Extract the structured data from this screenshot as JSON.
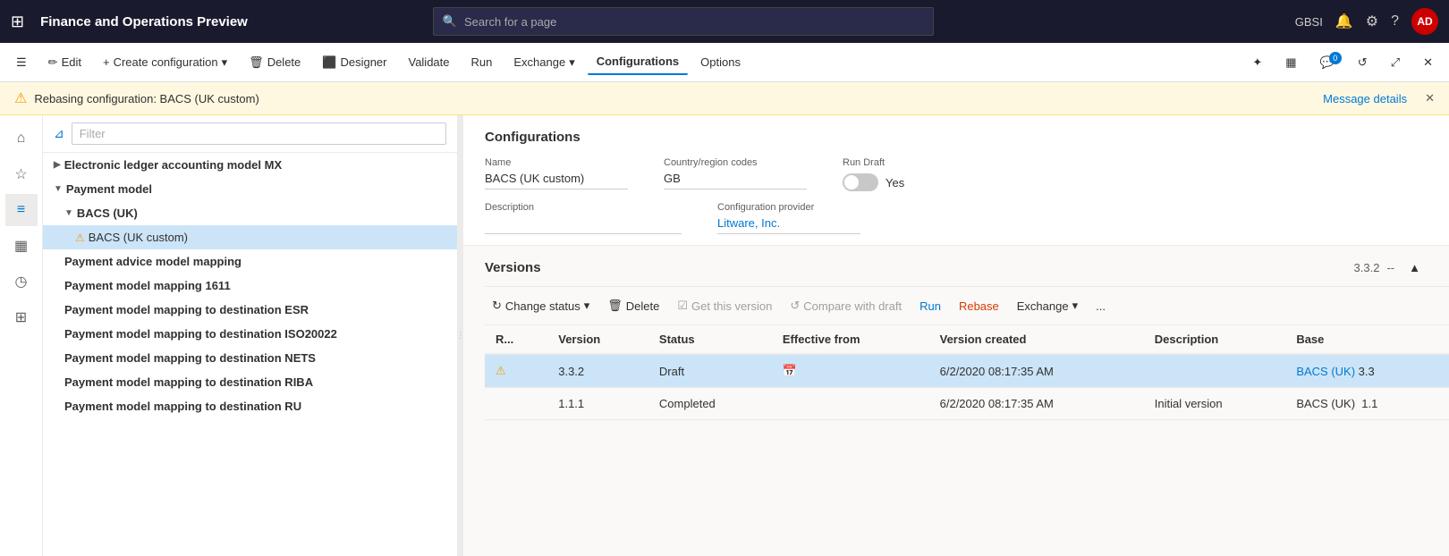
{
  "app": {
    "title": "Finance and Operations Preview",
    "grid_icon": "⊞"
  },
  "search": {
    "placeholder": "Search for a page"
  },
  "header_right": {
    "user_initials": "AD",
    "region": "GBSI"
  },
  "command_bar": {
    "edit": "Edit",
    "create_config": "Create configuration",
    "delete": "Delete",
    "designer": "Designer",
    "validate": "Validate",
    "run": "Run",
    "exchange": "Exchange",
    "configurations": "Configurations",
    "options": "Options"
  },
  "warning_banner": {
    "message": "Rebasing configuration: BACS (UK custom)",
    "link": "Message details"
  },
  "tree": {
    "filter_placeholder": "Filter",
    "items": [
      {
        "label": "Electronic ledger accounting model MX",
        "level": 1,
        "has_chevron": true,
        "collapsed": true,
        "warn": false
      },
      {
        "label": "Payment model",
        "level": 1,
        "has_chevron": true,
        "collapsed": false,
        "warn": false
      },
      {
        "label": "BACS (UK)",
        "level": 2,
        "has_chevron": true,
        "collapsed": false,
        "warn": false
      },
      {
        "label": "⚠BACS (UK custom)",
        "level": 3,
        "selected": true,
        "warn": true
      },
      {
        "label": "Payment advice model mapping",
        "level": 2,
        "has_chevron": false
      },
      {
        "label": "Payment model mapping 1611",
        "level": 2,
        "has_chevron": false
      },
      {
        "label": "Payment model mapping to destination ESR",
        "level": 2,
        "has_chevron": false
      },
      {
        "label": "Payment model mapping to destination ISO20022",
        "level": 2,
        "has_chevron": false
      },
      {
        "label": "Payment model mapping to destination NETS",
        "level": 2,
        "has_chevron": false
      },
      {
        "label": "Payment model mapping to destination RIBA",
        "level": 2,
        "has_chevron": false
      },
      {
        "label": "Payment model mapping to destination RU",
        "level": 2,
        "has_chevron": false
      }
    ]
  },
  "configurations": {
    "section_title": "Configurations",
    "name_label": "Name",
    "name_value": "BACS (UK custom)",
    "country_label": "Country/region codes",
    "country_value": "GB",
    "run_draft_label": "Run Draft",
    "run_draft_yes": "Yes",
    "description_label": "Description",
    "description_value": "",
    "provider_label": "Configuration provider",
    "provider_value": "Litware, Inc."
  },
  "versions": {
    "section_title": "Versions",
    "version_nav": "3.3.2",
    "nav_separator": "--",
    "toolbar": {
      "change_status": "Change status",
      "delete": "Delete",
      "get_this_version": "Get this version",
      "compare_with_draft": "Compare with draft",
      "run": "Run",
      "rebase": "Rebase",
      "exchange": "Exchange",
      "more": "..."
    },
    "columns": [
      "R...",
      "Version",
      "Status",
      "Effective from",
      "Version created",
      "Description",
      "Base"
    ],
    "rows": [
      {
        "warn": true,
        "row_indicator": "",
        "version": "3.3.2",
        "status": "Draft",
        "effective_from": "",
        "version_created": "6/2/2020 08:17:35 AM",
        "description": "",
        "base": "BACS (UK)",
        "base_version": "3.3",
        "highlight": true
      },
      {
        "warn": false,
        "row_indicator": "",
        "version": "1.1.1",
        "status": "Completed",
        "effective_from": "",
        "version_created": "6/2/2020 08:17:35 AM",
        "description": "Initial version",
        "base": "BACS (UK)",
        "base_version": "1.1",
        "highlight": false
      }
    ]
  }
}
